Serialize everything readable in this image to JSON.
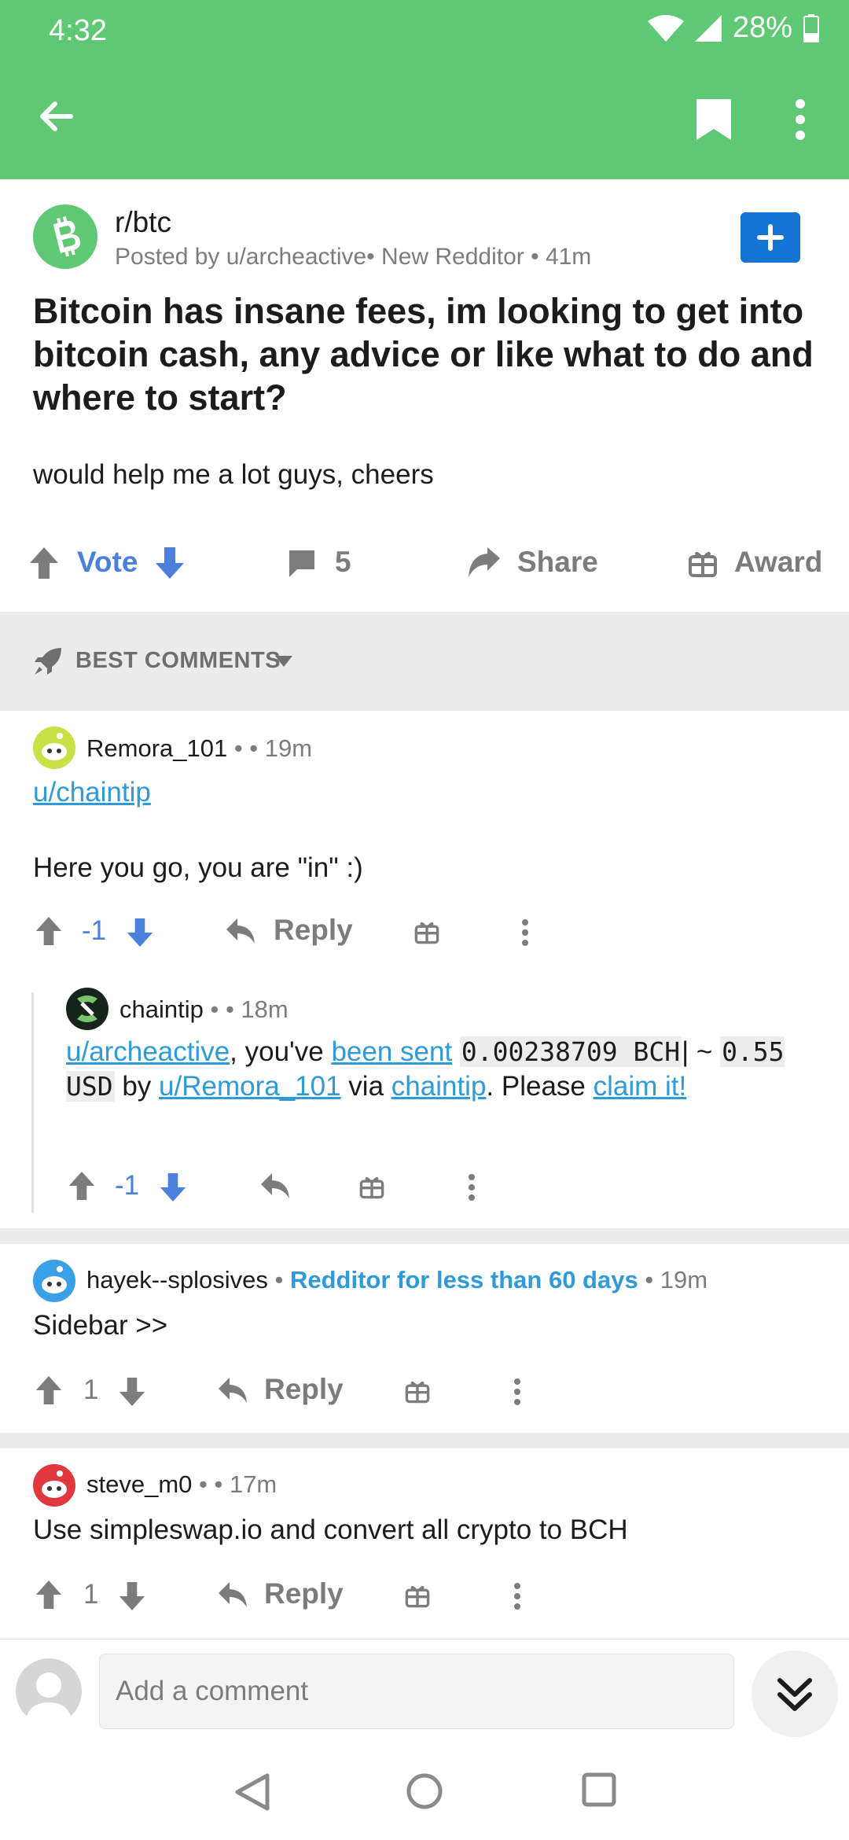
{
  "status_bar": {
    "time": "4:32",
    "battery": "28%"
  },
  "post": {
    "subreddit": "r/btc",
    "meta": "Posted by u/archeactive• New Redditor • 41m",
    "title": "Bitcoin has insane fees, im looking to get into bitcoin cash, any advice or like what to do and where to start?",
    "body": "would help me a lot guys, cheers",
    "vote_label": "Vote",
    "comment_count": "5",
    "share_label": "Share",
    "award_label": "Award"
  },
  "sort": {
    "label": "BEST COMMENTS"
  },
  "comments": [
    {
      "author": "Remora_101",
      "meta": " •  • 19m",
      "link": "u/chaintip",
      "text": "Here you go, you are \"in\" :)",
      "score": "-1",
      "reply_label": "Reply"
    },
    {
      "author": "chaintip",
      "meta": " •  • 18m",
      "text_parts": {
        "link_user": "u/archeactive",
        "t1": ", you've ",
        "link_sent": "been sent",
        "t2": " ",
        "code_amount": "0.00238709 BCH",
        "t3": "| ~ ",
        "code_usd": "0.55 USD",
        "t4": " by ",
        "link_from": "u/Remora_101",
        "t5": " via ",
        "link_chaintip": "chaintip",
        "t6": ". Please ",
        "link_claim": "claim it!"
      },
      "score": "-1"
    },
    {
      "author": "hayek--splosives",
      "flair": "Redditor for less than 60 days",
      "meta_before": " • ",
      "meta_after": " • 19m",
      "text": "Sidebar >>",
      "score": "1",
      "reply_label": "Reply"
    },
    {
      "author": "steve_m0",
      "meta": " •  • 17m",
      "text": "Use simpleswap.io and convert all crypto to BCH",
      "score": "1",
      "reply_label": "Reply"
    }
  ],
  "comment_bar": {
    "placeholder": "Add a comment"
  },
  "colors": {
    "brand_green": "#5fc874",
    "upvote_blue": "#4a7fdc",
    "link_blue": "#2f9ad8",
    "join_blue": "#1474d4"
  },
  "icons": [
    "wifi-icon",
    "signal-icon",
    "battery-icon",
    "back-arrow-icon",
    "bookmark-icon",
    "more-vert-icon",
    "plus-icon",
    "upvote-icon",
    "downvote-icon",
    "comment-icon",
    "share-icon",
    "award-icon",
    "rocket-icon",
    "chevron-down-icon",
    "reply-icon",
    "double-chevron-down-icon",
    "nav-back-icon",
    "nav-home-icon",
    "nav-recents-icon"
  ]
}
